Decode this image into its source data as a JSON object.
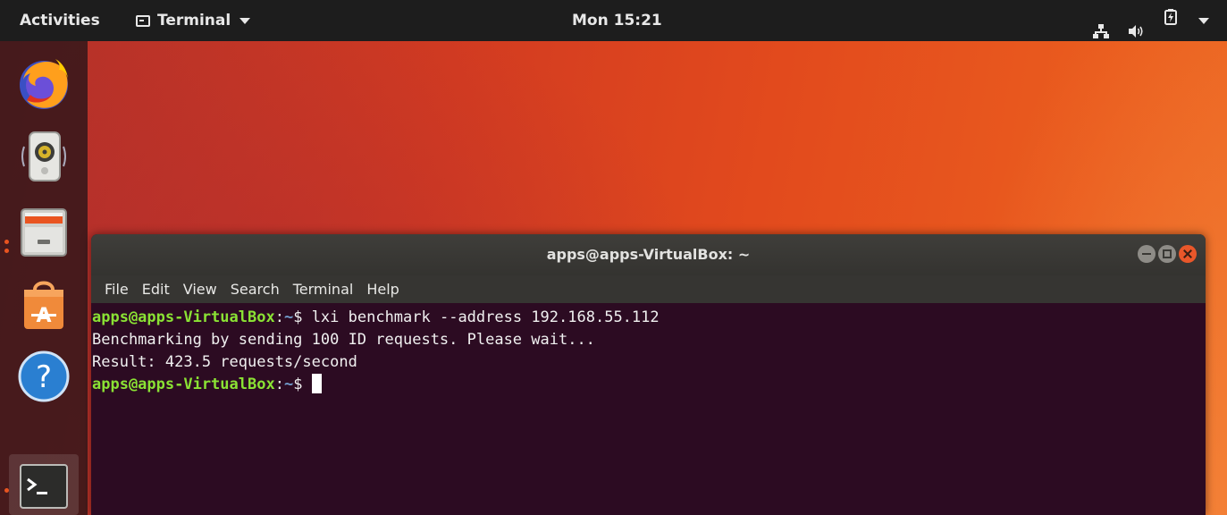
{
  "topbar": {
    "activities_label": "Activities",
    "app_menu_label": "Terminal",
    "clock": "Mon 15:21",
    "tray_icons": [
      "network-icon",
      "volume-icon",
      "battery-icon",
      "system-menu-arrow"
    ]
  },
  "dock": {
    "items": [
      {
        "name": "Firefox Web Browser",
        "icon": "firefox-icon",
        "running": false
      },
      {
        "name": "Rhythmbox",
        "icon": "rhythmbox-icon",
        "running": false
      },
      {
        "name": "Files",
        "icon": "files-icon",
        "running": true
      },
      {
        "name": "Ubuntu Software",
        "icon": "software-icon",
        "running": false
      },
      {
        "name": "Help",
        "icon": "help-icon",
        "running": false
      },
      {
        "name": "Terminal",
        "icon": "terminal-icon",
        "running": true
      }
    ]
  },
  "terminal": {
    "title": "apps@apps-VirtualBox: ~",
    "menu": [
      "File",
      "Edit",
      "View",
      "Search",
      "Terminal",
      "Help"
    ],
    "lines": [
      {
        "prompt_user": "apps@apps-VirtualBox",
        "prompt_sep": ":",
        "prompt_path": "~",
        "prompt_end": "$ ",
        "command": "lxi benchmark --address 192.168.55.112"
      },
      {
        "output": "Benchmarking by sending 100 ID requests. Please wait..."
      },
      {
        "output": "Result: 423.5 requests/second"
      },
      {
        "prompt_user": "apps@apps-VirtualBox",
        "prompt_sep": ":",
        "prompt_path": "~",
        "prompt_end": "$ ",
        "command": ""
      }
    ]
  },
  "colors": {
    "accent": "#e95420",
    "terminal_bg": "#2c0b22",
    "prompt_user": "#8ae234",
    "prompt_path": "#729fcf"
  }
}
